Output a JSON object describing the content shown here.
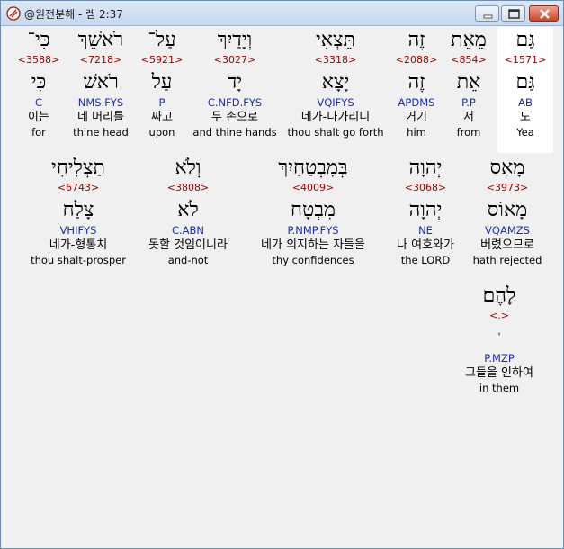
{
  "window": {
    "title": "@원전분해 - 렘 2:37",
    "buttons": {
      "minimize": "minimize",
      "maximize": "maximize",
      "close": "close"
    }
  },
  "words": [
    {
      "hebrew": "גַּם",
      "strongs": "<1571>",
      "root": "גַּם",
      "code": "AB",
      "korean": "도",
      "english": "Yea"
    },
    {
      "hebrew": "מֵאֵת",
      "strongs": "<854>",
      "root": "אֵת",
      "code": "P.P",
      "korean": "서",
      "english": "from"
    },
    {
      "hebrew": "זֶה",
      "strongs": "<2088>",
      "root": "זֶה",
      "code": "APDMS",
      "korean": "거기",
      "english": "him"
    },
    {
      "hebrew": "תֵּצְאִי",
      "strongs": "<3318>",
      "root": "יָצָא",
      "code": "VQIFYS",
      "korean": "네가-나가리니",
      "english": "thou shalt go forth"
    },
    {
      "hebrew": "וְיָדַיִךְ",
      "strongs": "<3027>",
      "root": "יָד",
      "code": "C.NFD.FYS",
      "korean": "두 손으로",
      "english": "and thine hands"
    },
    {
      "hebrew": "עַל־",
      "strongs": "<5921>",
      "root": "עַל",
      "code": "P",
      "korean": "싸고",
      "english": "upon"
    },
    {
      "hebrew": "רֹאשֵׁךְ",
      "strongs": "<7218>",
      "root": "רֹאשׁ",
      "code": "NMS.FYS",
      "korean": "네 머리를",
      "english": "thine head"
    },
    {
      "hebrew": "כִּי־",
      "strongs": "<3588>",
      "root": "כִּי",
      "code": "C",
      "korean": "이는",
      "english": "for"
    },
    {
      "hebrew": "מָאַס",
      "strongs": "<3973>",
      "root": "מָאוֹס",
      "code": "VQAMZS",
      "korean": "버렸으므로",
      "english": "hath rejected"
    },
    {
      "hebrew": "יְהוָה",
      "strongs": "<3068>",
      "root": "יְהוָה",
      "code": "NE",
      "korean": "나 여호와가",
      "english": "the LORD"
    },
    {
      "hebrew": "בְּמִבְטַחַיִךְ",
      "strongs": "<4009>",
      "root": "מִבְטָח",
      "code": "P.NMP.FYS",
      "korean": "네가 의지하는 자들을",
      "english": "thy confidences"
    },
    {
      "hebrew": "וְלֹא",
      "strongs": "<3808>",
      "root": "לֹא",
      "code": "C.ABN",
      "korean": "못할 것임이니라",
      "english": "and-not"
    },
    {
      "hebrew": "תַצְלִיחִי",
      "strongs": "<6743>",
      "root": "צָלַח",
      "code": "VHIFYS",
      "korean": "네가-형통치",
      "english": "thou shalt-prosper"
    },
    {
      "hebrew": "לָהֶם׃",
      "strongs": "<.>",
      "root": "ˈ",
      "code": "P.MZP",
      "korean": "그들을 인하여",
      "english": "in them"
    }
  ]
}
